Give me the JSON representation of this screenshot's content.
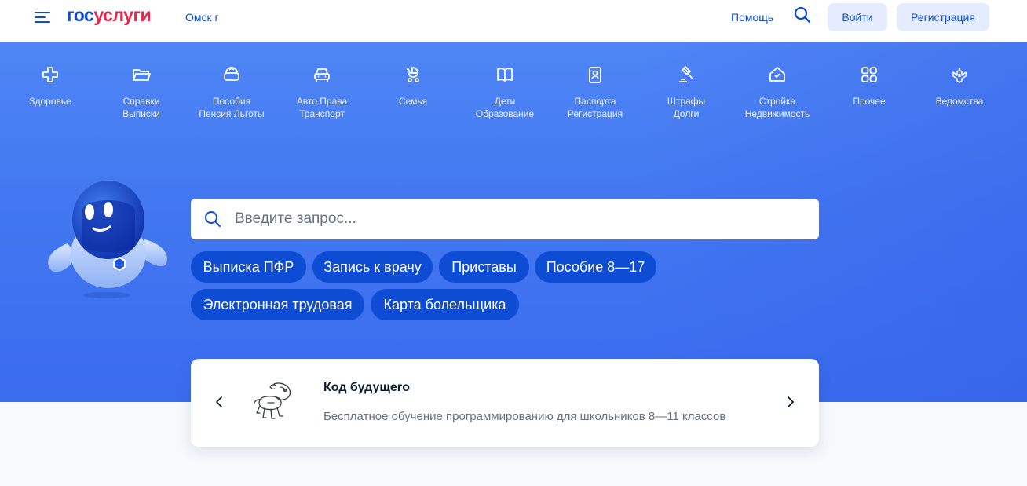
{
  "header": {
    "logo_part1": "гос",
    "logo_part2": "услуги",
    "city": "Омск г",
    "help": "Помощь",
    "login": "Войти",
    "register": "Регистрация"
  },
  "categories": [
    {
      "line1": "Здоровье",
      "line2": "",
      "icon": "health-cross-icon"
    },
    {
      "line1": "Справки",
      "line2": "Выписки",
      "icon": "folder-icon"
    },
    {
      "line1": "Пособия",
      "line2": "Пенсия Льготы",
      "icon": "wallet-icon"
    },
    {
      "line1": "Авто Права",
      "line2": "Транспорт",
      "icon": "car-icon"
    },
    {
      "line1": "Семья",
      "line2": "",
      "icon": "stroller-icon"
    },
    {
      "line1": "Дети",
      "line2": "Образование",
      "icon": "book-icon"
    },
    {
      "line1": "Паспорта",
      "line2": "Регистрация",
      "icon": "passport-icon"
    },
    {
      "line1": "Штрафы",
      "line2": "Долги",
      "icon": "gavel-icon"
    },
    {
      "line1": "Стройка",
      "line2": "Недвижимость",
      "icon": "house-icon"
    },
    {
      "line1": "Прочее",
      "line2": "",
      "icon": "grid-icon"
    },
    {
      "line1": "Ведомства",
      "line2": "",
      "icon": "emblem-icon"
    }
  ],
  "search": {
    "placeholder": "Введите запрос..."
  },
  "chips": [
    "Выписка ПФР",
    "Запись к врачу",
    "Приставы",
    "Пособие 8—17",
    "Электронная трудовая",
    "Карта болельщика"
  ],
  "promo": {
    "title": "Код будущего",
    "text": "Бесплатное обучение программированию для школьников 8—11 классов"
  },
  "colors": {
    "brand_blue": "#0d4cd3",
    "brand_red": "#e3264a",
    "hero_blue": "#4277f1"
  }
}
